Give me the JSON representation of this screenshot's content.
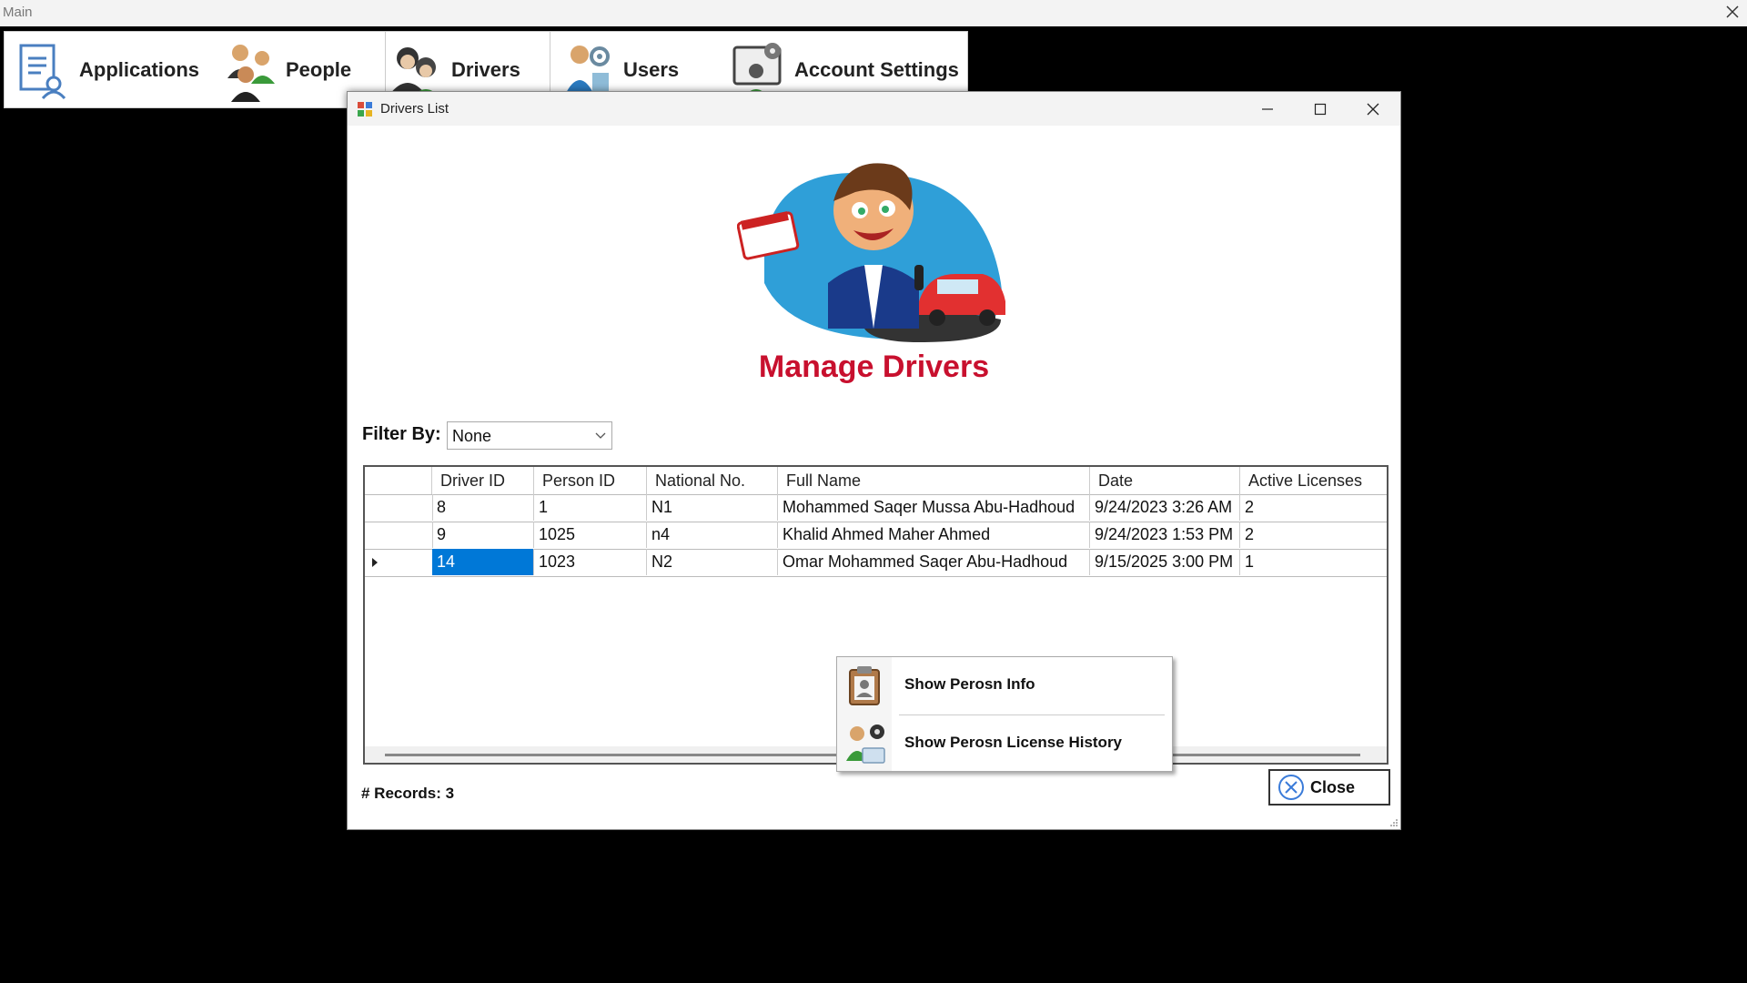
{
  "main_window": {
    "title": "Main"
  },
  "menu": {
    "items": [
      {
        "label": "Applications",
        "icon": "applications-icon"
      },
      {
        "label": "People",
        "icon": "people-icon"
      },
      {
        "label": "Drivers",
        "icon": "drivers-icon"
      },
      {
        "label": "Users",
        "icon": "users-icon"
      },
      {
        "label": "Account Settings",
        "icon": "account-settings-icon"
      }
    ]
  },
  "dialog": {
    "title": "Drivers List",
    "heading": "Manage Drivers",
    "heading_color": "#c8102e"
  },
  "filter": {
    "label": "Filter By:",
    "value": "None"
  },
  "grid": {
    "columns": [
      "Driver ID",
      "Person ID",
      "National No.",
      "Full Name",
      "Date",
      "Active Licenses"
    ],
    "rows": [
      [
        "8",
        "1",
        "N1",
        "Mohammed Saqer Mussa Abu-Hadhoud",
        "9/24/2023 3:26 AM",
        "2"
      ],
      [
        "9",
        "1025",
        "n4",
        "Khalid Ahmed Maher Ahmed",
        "9/24/2023 1:53 PM",
        "2"
      ],
      [
        "14",
        "1023",
        "N2",
        "Omar Mohammed Saqer Abu-Hadhoud",
        "9/15/2025 3:00 PM",
        "1"
      ]
    ],
    "selection_color": "#0078d7"
  },
  "context_menu": {
    "items": [
      {
        "label": "Show Perosn Info",
        "icon": "person-card-icon"
      },
      {
        "label": "Show Perosn License History",
        "icon": "license-history-icon"
      }
    ]
  },
  "footer": {
    "records_label": "# Records: 3",
    "close_label": "Close"
  }
}
